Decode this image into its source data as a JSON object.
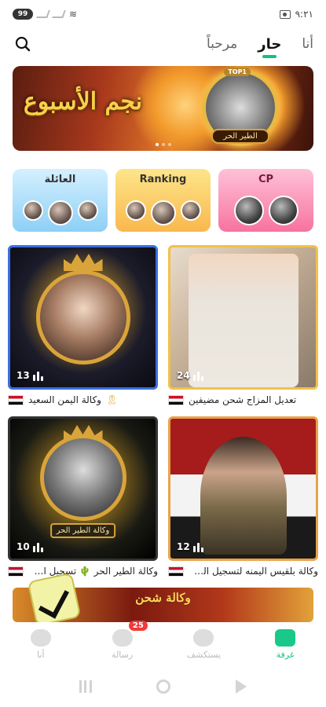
{
  "status_bar": {
    "battery": "99",
    "time": "٩:٢١"
  },
  "header": {
    "tabs": [
      {
        "label": "مرحباً"
      },
      {
        "label": "حار"
      },
      {
        "label": "أنا"
      }
    ]
  },
  "banner": {
    "title": "نجم الأسبوع",
    "badge": "TOP1",
    "name": "الطير الحر"
  },
  "categories": [
    {
      "label": "العائلة"
    },
    {
      "label": "Ranking"
    },
    {
      "label": "CP"
    }
  ],
  "rooms": [
    {
      "count": "13",
      "title": "وكالة اليمن السعيد"
    },
    {
      "count": "24",
      "title": "تعديل المزاج شحن مضيفين"
    },
    {
      "count": "10",
      "title": "وكالة الطير الحر 🌵 تسجيل ال...",
      "plate": "وكالة الطير الحر"
    },
    {
      "count": "12",
      "title": "وكالة بلقيس اليمنه لتسجيل الم..."
    }
  ],
  "promo": {
    "text": "وكالة شحن"
  },
  "bottom_nav": [
    {
      "label": "أنا"
    },
    {
      "label": "رسالة",
      "badge": "25"
    },
    {
      "label": "يستكشف"
    },
    {
      "label": "غرفة"
    }
  ],
  "colors": {
    "accent": "#10c37a",
    "badge": "#f23a3a"
  }
}
